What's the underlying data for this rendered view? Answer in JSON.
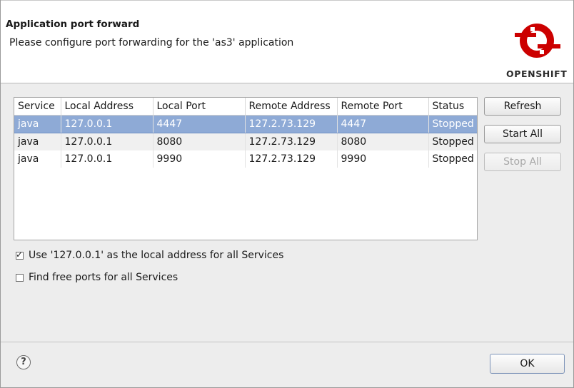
{
  "header": {
    "title": "Application port forward",
    "message": "Please configure port forwarding for the 'as3' application",
    "logo_text": "OPENSHIFT",
    "logo_color": "#cc0000"
  },
  "table": {
    "columns": [
      "Service",
      "Local Address",
      "Local Port",
      "Remote Address",
      "Remote Port",
      "Status"
    ],
    "rows": [
      [
        "java",
        "127.0.0.1",
        "4447",
        "127.2.73.129",
        "4447",
        "Stopped"
      ],
      [
        "java",
        "127.0.0.1",
        "8080",
        "127.2.73.129",
        "8080",
        "Stopped"
      ],
      [
        "java",
        "127.0.0.1",
        "9990",
        "127.2.73.129",
        "9990",
        "Stopped"
      ]
    ],
    "selected_row": 0,
    "selection_color": "#8eaad6"
  },
  "buttons": {
    "refresh": "Refresh",
    "start_all": "Start All",
    "stop_all": "Stop All",
    "ok": "OK"
  },
  "options": {
    "use_local_address": {
      "label": "Use '127.0.0.1' as the local address for all Services",
      "checked": true
    },
    "find_free_ports": {
      "label": "Find free ports for all Services",
      "checked": false
    }
  },
  "help_icon": "question-mark-icon"
}
